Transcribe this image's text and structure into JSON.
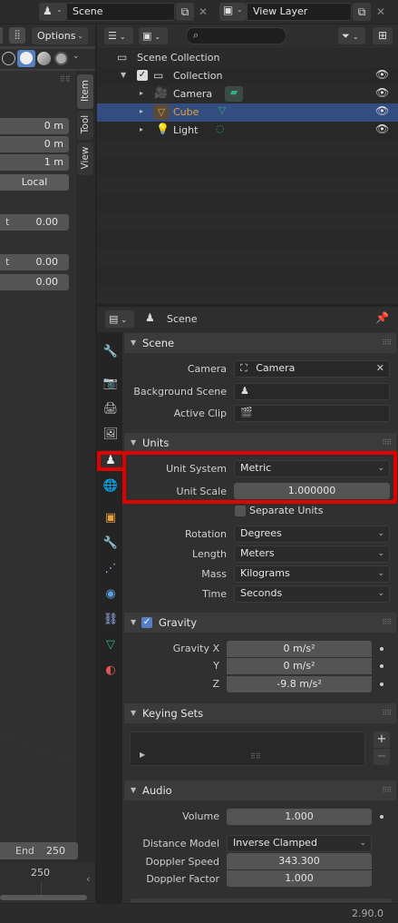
{
  "topbar": {
    "scene_name": "Scene",
    "view_layer_name": "View Layer"
  },
  "viewport": {
    "options_label": "Options",
    "side_tabs": [
      "Item",
      "Tool",
      "View"
    ],
    "fields": [
      "0 m",
      "0 m",
      "1 m"
    ],
    "local_label": "Local",
    "values": [
      "0.00",
      "0.00",
      "0.00"
    ],
    "partial_labels": [
      "t",
      "t"
    ],
    "timeline": {
      "end_label": "End",
      "end_value": "250",
      "frame_marker": "250"
    }
  },
  "outliner": {
    "root": "Scene Collection",
    "collection": "Collection",
    "items": [
      "Camera",
      "Cube",
      "Light"
    ]
  },
  "properties": {
    "context": "Scene",
    "scene_panel": {
      "title": "Scene",
      "camera_label": "Camera",
      "camera_value": "Camera",
      "background_scene_label": "Background Scene",
      "active_clip_label": "Active Clip"
    },
    "units_panel": {
      "title": "Units",
      "unit_system_label": "Unit System",
      "unit_system_value": "Metric",
      "unit_scale_label": "Unit Scale",
      "unit_scale_value": "1.000000",
      "separate_units_label": "Separate Units",
      "rotation_label": "Rotation",
      "rotation_value": "Degrees",
      "length_label": "Length",
      "length_value": "Meters",
      "mass_label": "Mass",
      "mass_value": "Kilograms",
      "time_label": "Time",
      "time_value": "Seconds"
    },
    "gravity_panel": {
      "title": "Gravity",
      "x_label": "Gravity X",
      "x_value": "0 m/s²",
      "y_label": "Y",
      "y_value": "0 m/s²",
      "z_label": "Z",
      "z_value": "-9.8 m/s²"
    },
    "keying_panel": {
      "title": "Keying Sets"
    },
    "audio_panel": {
      "title": "Audio",
      "volume_label": "Volume",
      "volume_value": "1.000",
      "distance_model_label": "Distance Model",
      "distance_model_value": "Inverse Clamped",
      "doppler_speed_label": "Doppler Speed",
      "doppler_speed_value": "343.300",
      "doppler_factor_label": "Doppler Factor",
      "doppler_factor_value": "1.000"
    }
  },
  "statusbar": {
    "version": "2.90.0"
  },
  "colors": {
    "highlight": "#e00000",
    "selection": "#334d80",
    "cube_text": "#e8a03a",
    "camera_icon": "#e8a03a",
    "data_icon": "#2fb08a"
  }
}
